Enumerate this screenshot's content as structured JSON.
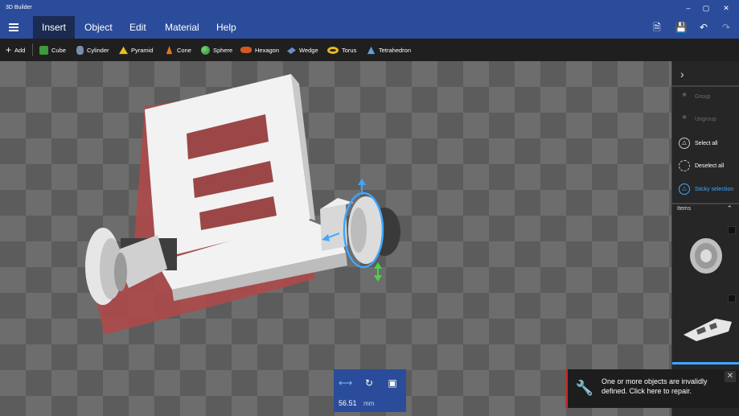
{
  "window": {
    "title": "3D Builder",
    "min_icon": "minimize-icon",
    "max_icon": "maximize-icon",
    "close_icon": "close-icon"
  },
  "menu": {
    "tabs": [
      {
        "label": "Insert",
        "active": true
      },
      {
        "label": "Object",
        "active": false
      },
      {
        "label": "Edit",
        "active": false
      },
      {
        "label": "Material",
        "active": false
      },
      {
        "label": "Help",
        "active": false
      }
    ],
    "right_icons": [
      "open-file-icon",
      "save-icon",
      "undo-icon",
      "redo-icon"
    ]
  },
  "toolbar": {
    "add_label": "Add",
    "shapes": [
      {
        "label": "Cube",
        "color": "#3c9a3c"
      },
      {
        "label": "Cylinder",
        "color": "#7a8fb0"
      },
      {
        "label": "Pyramid",
        "color": "#e8c020"
      },
      {
        "label": "Cone",
        "color": "#e07a1a"
      },
      {
        "label": "Sphere",
        "color": "#3aa43a"
      },
      {
        "label": "Hexagon",
        "color": "#d05a20"
      },
      {
        "label": "Wedge",
        "color": "#6c8cc4"
      },
      {
        "label": "Torus",
        "color": "#e8b820"
      },
      {
        "label": "Tetrahedron",
        "color": "#5fa0d8"
      }
    ]
  },
  "side_panel": {
    "group": "Group",
    "ungroup": "Ungroup",
    "select_all": "Select all",
    "deselect_all": "Deselect all",
    "sticky_selection": "Sticky selection",
    "items_header": "Items"
  },
  "measure": {
    "value": "56.51",
    "unit": "mm"
  },
  "notification": {
    "message": "One or more objects are invalidly defined. Click here to repair."
  },
  "colors": {
    "accent": "#2b4c9a",
    "selection": "#3ea6ff",
    "error": "#c42b2b"
  }
}
